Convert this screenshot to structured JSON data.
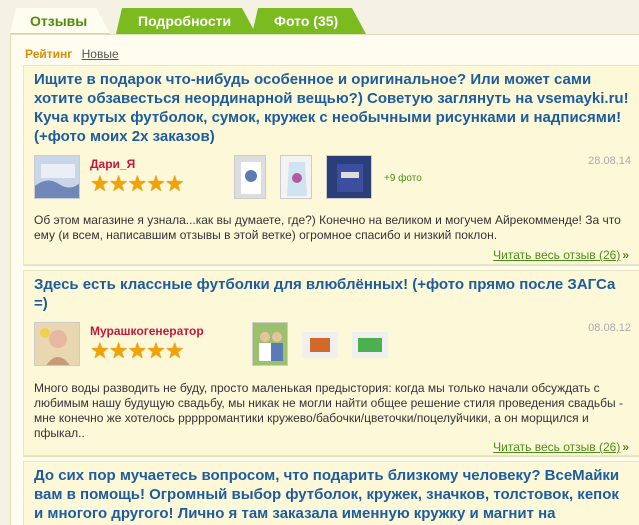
{
  "tabs": [
    {
      "label": "Отзывы",
      "active": true
    },
    {
      "label": "Подробности",
      "active": false
    },
    {
      "label": "Фото (35)",
      "active": false
    }
  ],
  "sort": {
    "active": "Рейтинг",
    "other": "Новые"
  },
  "reviews": [
    {
      "title": "Ищите в подарок что-нибудь особенное и оригинальное? Или может сами хотите обзавесться неординарной вещью?) Советую заглянуть на vsemayki.ru! Куча крутых футболок, сумок, кружек с необычными рисунками и надписями! (+фото моих 2х заказов)",
      "author": "Дари_Я",
      "stars": "★★★★★",
      "date": "28.08.14",
      "more_photos": "+9 фото",
      "body": "Об этом магазине я узнала...как вы думаете, где?) Конечно на великом и могучем Айрекомменде! За что ему (и всем, написавшим отзывы в этой ветке) огромное спасибо и низкий поклон.",
      "read_more": "Читать весь отзыв (26)"
    },
    {
      "title": "Здесь есть классные футболки для влюблённых! (+фото прямо после ЗАГСа =)",
      "author": "Мурашкогенератор",
      "stars": "★★★★★",
      "date": "08.08.12",
      "body": "Много воды разводить не буду, просто маленькая предыстория: когда мы только начали обсуждать с любимым нашу будущую свадьбу, мы никак не могли найти общее решение стиля проведения свадьбы - мне конечно же хотелось ррррромантики кружево/бабочки/цветочки/поцелуйчики, а он морщился и пфыкал..",
      "read_more": "Читать весь отзыв (26)"
    },
    {
      "title": "До сих пор мучаетесь вопросом, что подарить близкому человеку? ВсеМайки вам в помощь! Огромный выбор футболок, кружек, значков, толстовок, кепок и многого другого! Лично я там заказала именную кружку и магнит на бабушкин юбилей!!!"
    }
  ],
  "colors": {
    "tab_green": "#7cbb1f",
    "title_blue": "#1d5c9e",
    "author_red": "#c2183c",
    "star_orange": "#f3a300",
    "link_green": "#4a8d1a"
  }
}
